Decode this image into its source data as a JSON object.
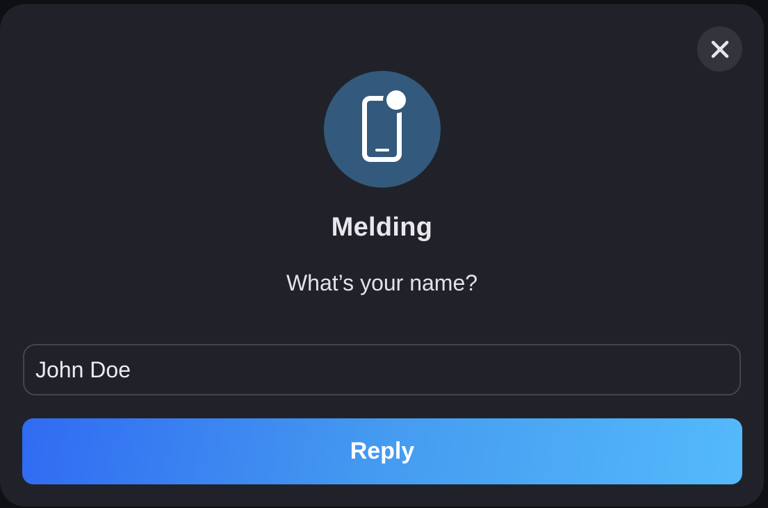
{
  "dialog": {
    "close_icon": "close-icon",
    "app_icon": "phone-notification-icon",
    "title": "Melding",
    "question": "What’s your name?",
    "input": {
      "value": "John Doe",
      "placeholder": ""
    },
    "reply_label": "Reply"
  },
  "colors": {
    "dialog_background": "#212229",
    "icon_circle": "#335a7c",
    "button_gradient_start": "#306bf2",
    "button_gradient_end": "#54b9fb"
  }
}
